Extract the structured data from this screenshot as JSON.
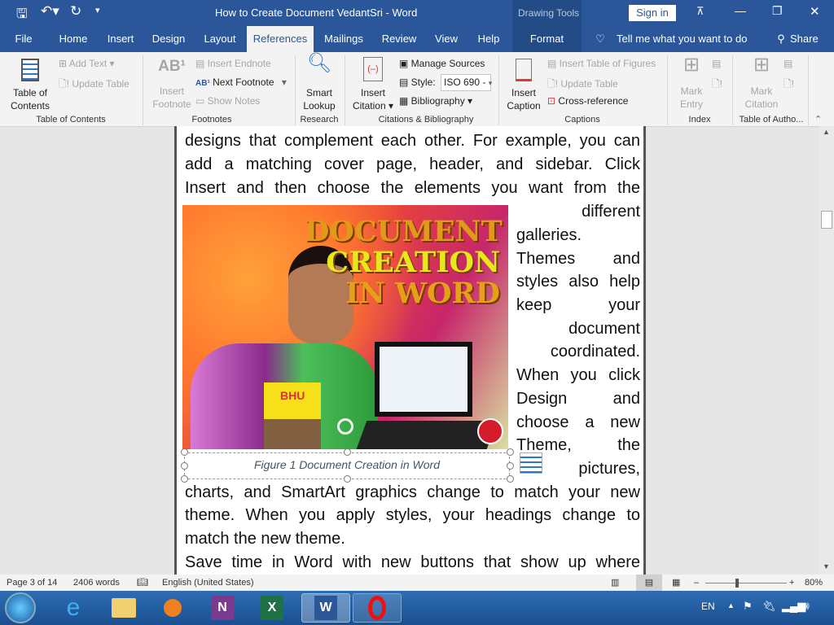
{
  "titlebar": {
    "title": "How to Create Document VedantSri  -  Word",
    "context_group": "Drawing Tools",
    "sign_in": "Sign in"
  },
  "tabs": [
    "File",
    "Home",
    "Insert",
    "Design",
    "Layout",
    "References",
    "Mailings",
    "Review",
    "View",
    "Help",
    "Format"
  ],
  "active_tab": "References",
  "tell_me": "Tell me what you want to do",
  "share": "Share",
  "ribbon": {
    "toc": {
      "big": "Table of Contents",
      "add_text": "Add Text",
      "update_table": "Update Table",
      "group": "Table of Contents"
    },
    "footnotes": {
      "big": "Insert Footnote",
      "insert_endnote": "Insert Endnote",
      "next_footnote": "Next Footnote",
      "show_notes": "Show Notes",
      "group": "Footnotes"
    },
    "research": {
      "big": "Smart Lookup",
      "group": "Research"
    },
    "citations": {
      "big": "Insert Citation",
      "manage_sources": "Manage Sources",
      "style_label": "Style:",
      "style_value": "ISO 690 -",
      "bibliography": "Bibliography",
      "group": "Citations & Bibliography"
    },
    "captions": {
      "big": "Insert Caption",
      "insert_tof": "Insert Table of Figures",
      "update_table": "Update Table",
      "cross_reference": "Cross-reference",
      "group": "Captions"
    },
    "index": {
      "big": "Mark Entry",
      "group": "Index"
    },
    "toa": {
      "big": "Mark Citation",
      "group": "Table of Autho..."
    }
  },
  "document": {
    "lines": [
      "designs that complement each other. For example, you can",
      "add a matching cover page, header, and sidebar. Click",
      "Insert and then choose the elements you want from the",
      "different",
      "galleries.",
      "Themes and",
      "styles also help",
      "keep your",
      "document",
      "coordinated.",
      "When you click",
      "Design and",
      "choose a new",
      "Theme, the",
      "pictures,",
      "charts, and SmartArt graphics change to match your new",
      "theme. When you apply styles, your headings change to",
      "match the new theme.",
      "Save time in Word with new buttons that show up where"
    ],
    "image_text": [
      "DOCUMENT",
      "CREATION",
      "IN WORD"
    ],
    "image_book": "BHU",
    "caption": "Figure 1 Document Creation in Word"
  },
  "status": {
    "page": "Page 3 of 14",
    "words": "2406 words",
    "language": "English (United States)",
    "zoom": "80%"
  },
  "taskbar": {
    "lang": "EN"
  }
}
